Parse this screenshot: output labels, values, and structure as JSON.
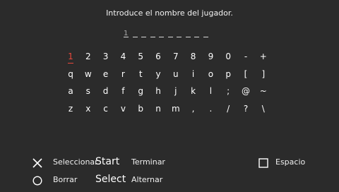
{
  "prompt": "Introduce el nombre del jugador.",
  "name_field": {
    "cursor": "1",
    "slot_count": 10
  },
  "keyboard": {
    "selected": "1",
    "rows": [
      [
        "1",
        "2",
        "3",
        "4",
        "5",
        "6",
        "7",
        "8",
        "9",
        "0",
        "-",
        "+"
      ],
      [
        "q",
        "w",
        "e",
        "r",
        "t",
        "y",
        "u",
        "i",
        "o",
        "p",
        "[",
        "]"
      ],
      [
        "a",
        "s",
        "d",
        "f",
        "g",
        "h",
        "j",
        "k",
        "l",
        ";",
        "@",
        "~"
      ],
      [
        "z",
        "x",
        "c",
        "v",
        "b",
        "n",
        "m",
        ",",
        ".",
        "/",
        "?",
        "\\"
      ]
    ]
  },
  "hints": {
    "select": {
      "icon": "cross-icon",
      "label": "Seleccionar"
    },
    "start": {
      "button": "Start",
      "label": "Terminar"
    },
    "space": {
      "icon": "square-icon",
      "label": "Espacio"
    },
    "delete": {
      "icon": "circle-icon",
      "label": "Borrar"
    },
    "select_button": {
      "button": "Select",
      "label": "Alternar"
    }
  },
  "colors": {
    "background": "#2b2b2b",
    "text": "#ffffff",
    "highlight": "#e8483c"
  }
}
